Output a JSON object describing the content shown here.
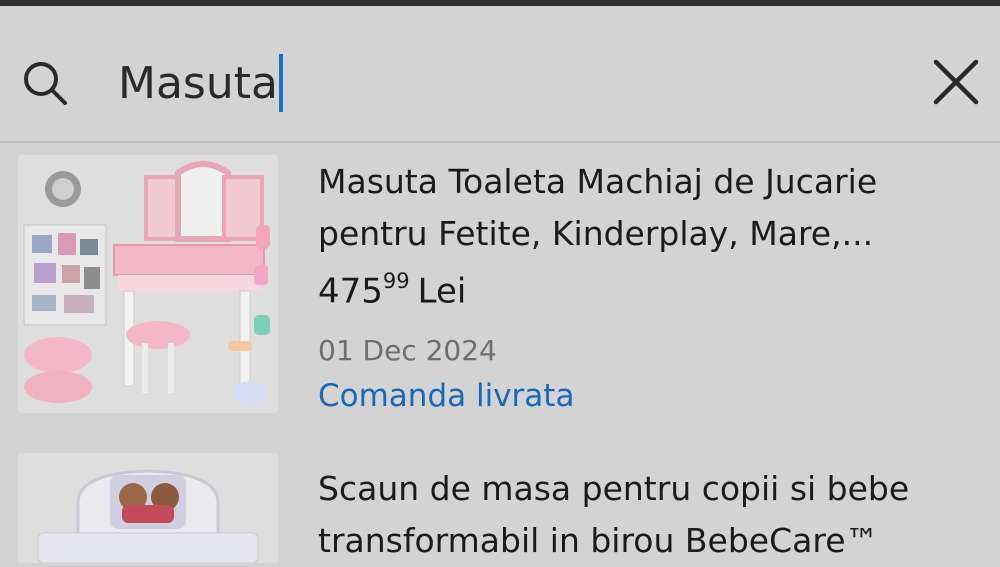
{
  "search": {
    "query": "Masuta"
  },
  "results": [
    {
      "title_line1": "Masuta Toaleta Machiaj de Jucarie",
      "title_line2": "pentru Fetite, Kinderplay, Mare,...",
      "price_integer": "475",
      "price_decimals": "99",
      "currency": "Lei",
      "date": "01 Dec 2024",
      "status": "Comanda livrata",
      "status_color": "#1a68b8"
    },
    {
      "title_line1": "Scaun de masa pentru copii si bebe",
      "title_line2": "transformabil in birou BebeCare™"
    }
  ],
  "colors": {
    "background": "#d3d3d3",
    "caret": "#1a6fd6",
    "link": "#1a68b8"
  },
  "icons": {
    "search": "search-icon",
    "close": "close-icon"
  }
}
